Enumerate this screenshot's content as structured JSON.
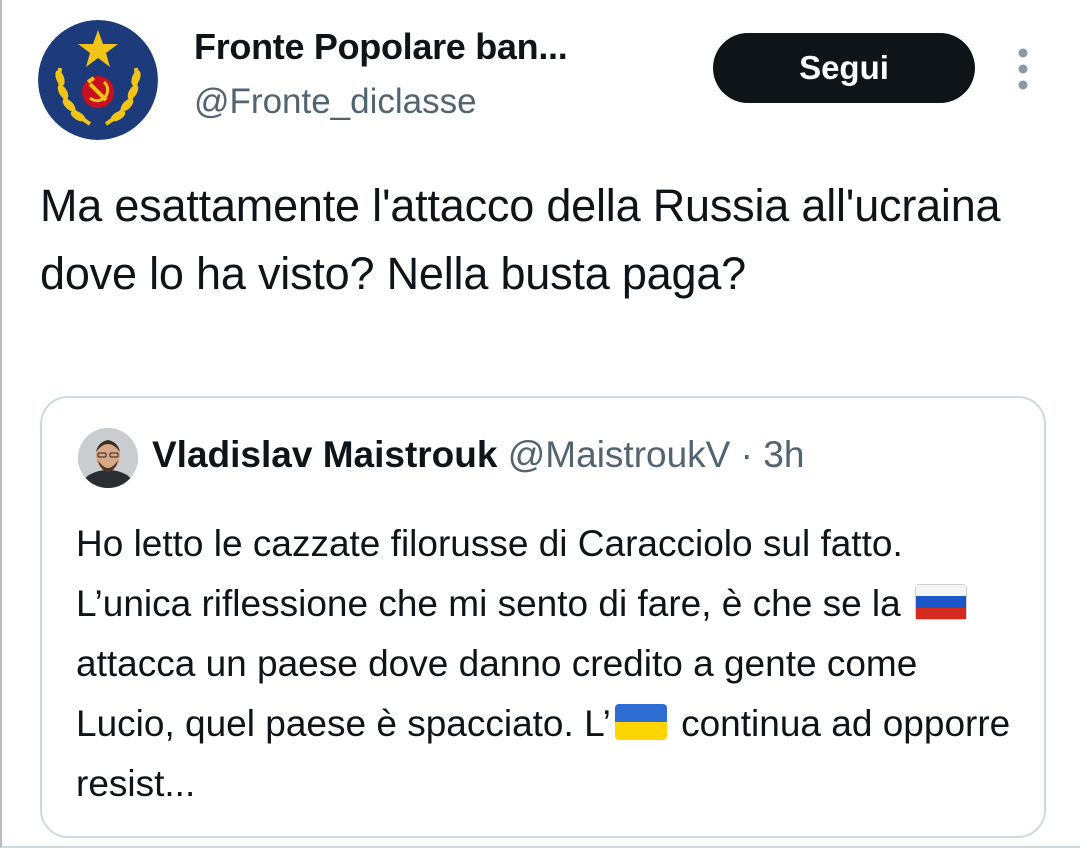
{
  "author": {
    "display_name": "Fronte Popolare ban...",
    "handle": "@Fronte_diclasse",
    "avatar_icon": "hammer-sickle-star-emblem"
  },
  "follow_button": {
    "label": "Segui"
  },
  "more_icon": "more-vertical-icon",
  "tweet": {
    "text": "Ma esattamente l'attacco della Russia all'ucraina dove lo ha visto? Nella busta paga?"
  },
  "quoted_tweet": {
    "author_name": "Vladislav Maistrouk",
    "author_handle": "@MaistroukV",
    "separator": "·",
    "time": "3h",
    "text_part1": "Ho letto le cazzate filorusse di Caracciolo sul fatto. L’unica riflessione che mi sento di fare, è che se la",
    "flag1": "russia-flag",
    "text_part2": "attacca un paese dove danno credito a gente come Lucio, quel paese è spacciato. L’",
    "flag2": "ukraine-flag",
    "text_part3": "continua ad opporre resist..."
  },
  "colors": {
    "text_primary": "#0f1419",
    "text_secondary": "#536471",
    "border": "#cfd9de",
    "button_bg": "#0f1419",
    "emblem_blue": "#1d3a7a",
    "emblem_gold": "#f2c418",
    "emblem_red": "#c8101e"
  }
}
